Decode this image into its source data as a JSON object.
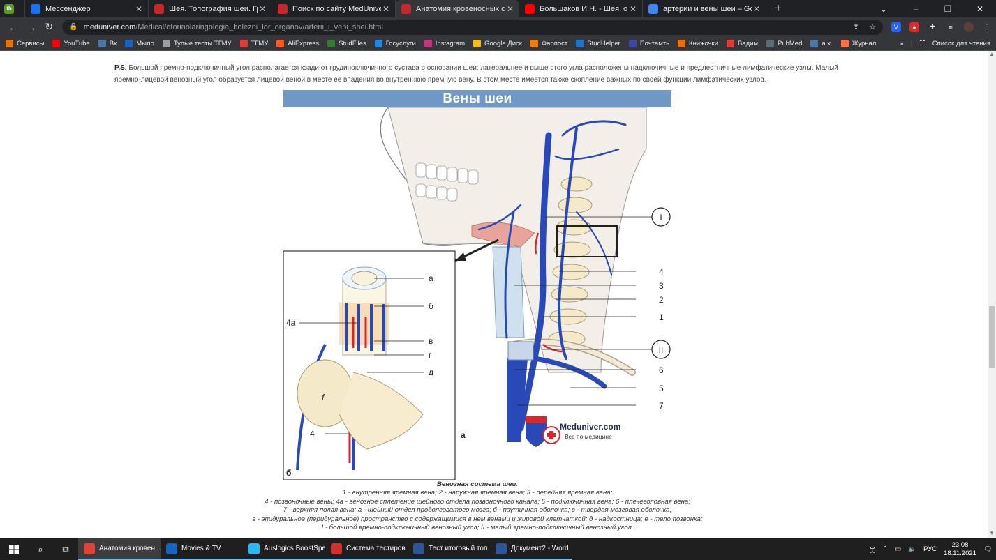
{
  "browser": {
    "tabs": [
      {
        "title": "Мессенджер",
        "icon": "messenger-icon",
        "color": "#1a73e8",
        "active": false
      },
      {
        "title": "Шея. Топография шеи. Границ",
        "icon": "meduniver-icon",
        "color": "#c62828",
        "active": false
      },
      {
        "title": "Поиск по сайту MedUniver.com",
        "icon": "meduniver-icon",
        "color": "#c62828",
        "active": false
      },
      {
        "title": "Анатомия кровеносных сосудо",
        "icon": "meduniver-icon",
        "color": "#c62828",
        "active": true
      },
      {
        "title": "Большаков И.Н. - Шея, операти",
        "icon": "youtube-icon",
        "color": "#ff0000",
        "active": false
      },
      {
        "title": "артерии и вены шеи – Google П",
        "icon": "google-icon",
        "color": "#4285f4",
        "active": false
      }
    ],
    "first_tab_badge": "th",
    "url_host": "meduniver.com",
    "url_path": "/Medical/otorinolaringologia_bolezni_lor_organov/arterii_i_veni_shei.html",
    "bookmarks": [
      {
        "label": "Сервисы",
        "color": "#e8710a"
      },
      {
        "label": "YouTube",
        "color": "#ff0000"
      },
      {
        "label": "Вк",
        "color": "#4a76a8"
      },
      {
        "label": "Мыло",
        "color": "#1565c0"
      },
      {
        "label": "Тупые тесты ТГМУ",
        "color": "#9e9e9e"
      },
      {
        "label": "ТГМУ",
        "color": "#e53935"
      },
      {
        "label": "AliExpress",
        "color": "#ff5722"
      },
      {
        "label": "StudFiles",
        "color": "#2e7d32"
      },
      {
        "label": "Госуслуги",
        "color": "#1e88e5"
      },
      {
        "label": "Instagram",
        "color": "#c13584"
      },
      {
        "label": "Google Диск",
        "color": "#fbbc04"
      },
      {
        "label": "Фарпост",
        "color": "#f57c00"
      },
      {
        "label": "StudHelper",
        "color": "#1976d2"
      },
      {
        "label": "Почтамть",
        "color": "#3949ab"
      },
      {
        "label": "Книжочки",
        "color": "#ef6c00"
      },
      {
        "label": "Вадим",
        "color": "#e53935"
      },
      {
        "label": "PubMed",
        "color": "#546e7a"
      },
      {
        "label": "а.х.",
        "color": "#4a76a8"
      },
      {
        "label": "Журнал",
        "color": "#ff7043"
      }
    ],
    "reading_list": "Список для чтения"
  },
  "page": {
    "ps_bold": "P.S.",
    "ps_text": " Большой яремно-подключичный угол располагается кзади от грудиноключичного сустава в основании шеи; латеральнее и выше этого угла расположены надключичные и предлестничные лимфатические узлы. Малый яремно-лицевой венозный угол образуется лицевой веной в месте ее впадения во внутреннюю яремную вену. В этом месте имеется также скопление важных по своей функции лимфатических узлов.",
    "figure_title": "Вены шеи",
    "figure_labels": {
      "roman_1": "I",
      "roman_2": "II",
      "n4": "4",
      "n3": "3",
      "n2": "2",
      "n1": "1",
      "n6": "6",
      "n5": "5",
      "n7": "7",
      "a": "а",
      "b": "б",
      "v": "в",
      "g": "г",
      "d": "д",
      "f": "f",
      "n4a": "4а",
      "n4b": "4",
      "panel_a": "а",
      "panel_b": "б"
    },
    "logo_text": "Meduniver.com",
    "logo_sub": "Все по медицине",
    "caption_title": "Венозная система шеи",
    "caption_lines": [
      "1 - внутренняя яремная вена; 2 - наружная яремная вена; 3 - передняя яремная вена;",
      "4 - позвоночные вены; 4а - венозное сплетение шейного отдела позвоночного канала; 5 - подключичная вена; 6 - плечеголовная вена;",
      "7 - верхняя полая вена; а - шейный отдел продолговатого мозга; б - паутинная оболочка; в - твердая мозговая оболочка;",
      "г - эпидуральное (перидуральное) пространство с содержащимися в нем венами и жировой клетчаткой; д - надкостница; е - тело позвонка;",
      "I - большой яремно-подключичный венозный угол; II - малый яремно-подключичный венозный угол."
    ]
  },
  "taskbar": {
    "apps": [
      {
        "label": "Анатомия кровен...",
        "color": "#db4437",
        "active": true
      },
      {
        "label": "Movies & TV",
        "color": "#1565c0",
        "active": false
      },
      {
        "label": "Auslogics BoostSpe...",
        "color": "#29b6f6",
        "active": false
      },
      {
        "label": "Система тестиров...",
        "color": "#d32f2f",
        "active": false
      },
      {
        "label": "Тест итоговый топ...",
        "color": "#2b579a",
        "active": false
      },
      {
        "label": "Документ2 - Word",
        "color": "#2b579a",
        "active": false
      }
    ],
    "lang": "РУС",
    "time": "23:08",
    "date": "18.11.2021"
  }
}
